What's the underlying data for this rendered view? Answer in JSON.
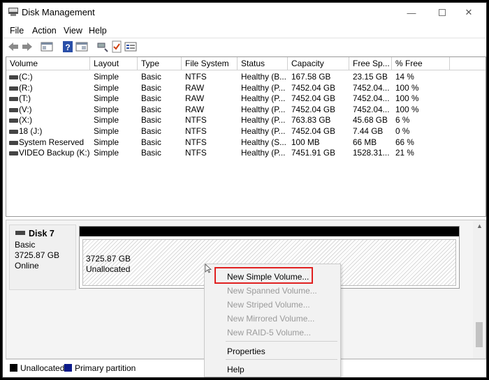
{
  "window": {
    "title": "Disk Management"
  },
  "menu": {
    "file": "File",
    "action": "Action",
    "view": "View",
    "help": "Help"
  },
  "toolbar": {
    "icons": [
      "back-arrow-icon",
      "forward-arrow-icon",
      "console-tree-icon",
      "help-icon",
      "properties-icon",
      "connect-icon",
      "checklist-icon",
      "view-icon"
    ]
  },
  "volume_table": {
    "headers": [
      "Volume",
      "Layout",
      "Type",
      "File System",
      "Status",
      "Capacity",
      "Free Sp...",
      "% Free"
    ],
    "rows": [
      {
        "volume": "(C:)",
        "layout": "Simple",
        "type": "Basic",
        "fs": "NTFS",
        "status": "Healthy (B...",
        "capacity": "167.58 GB",
        "free": "23.15 GB",
        "pct": "14 %"
      },
      {
        "volume": "(R:)",
        "layout": "Simple",
        "type": "Basic",
        "fs": "RAW",
        "status": "Healthy (P...",
        "capacity": "7452.04 GB",
        "free": "7452.04...",
        "pct": "100 %"
      },
      {
        "volume": "(T:)",
        "layout": "Simple",
        "type": "Basic",
        "fs": "RAW",
        "status": "Healthy (P...",
        "capacity": "7452.04 GB",
        "free": "7452.04...",
        "pct": "100 %"
      },
      {
        "volume": "(V:)",
        "layout": "Simple",
        "type": "Basic",
        "fs": "RAW",
        "status": "Healthy (P...",
        "capacity": "7452.04 GB",
        "free": "7452.04...",
        "pct": "100 %"
      },
      {
        "volume": "(X:)",
        "layout": "Simple",
        "type": "Basic",
        "fs": "NTFS",
        "status": "Healthy (P...",
        "capacity": "763.83 GB",
        "free": "45.68 GB",
        "pct": "6 %"
      },
      {
        "volume": "18 (J:)",
        "layout": "Simple",
        "type": "Basic",
        "fs": "NTFS",
        "status": "Healthy (P...",
        "capacity": "7452.04 GB",
        "free": "7.44 GB",
        "pct": "0 %"
      },
      {
        "volume": "System Reserved",
        "layout": "Simple",
        "type": "Basic",
        "fs": "NTFS",
        "status": "Healthy (S...",
        "capacity": "100 MB",
        "free": "66 MB",
        "pct": "66 %"
      },
      {
        "volume": "VIDEO Backup (K:)",
        "layout": "Simple",
        "type": "Basic",
        "fs": "NTFS",
        "status": "Healthy (P...",
        "capacity": "7451.91 GB",
        "free": "1528.31...",
        "pct": "21 %"
      }
    ]
  },
  "disk": {
    "name": "Disk 7",
    "type": "Basic",
    "size": "3725.87 GB",
    "status": "Online",
    "partition_size": "3725.87 GB",
    "partition_state": "Unallocated"
  },
  "legend": {
    "unallocated": "Unallocated",
    "primary": "Primary partition",
    "unallocated_color": "#000000",
    "primary_color": "#0b1a8a"
  },
  "context_menu": {
    "new_simple": "New Simple Volume...",
    "new_spanned": "New Spanned Volume...",
    "new_striped": "New Striped Volume...",
    "new_mirrored": "New Mirrored Volume...",
    "new_raid5": "New RAID-5 Volume...",
    "properties": "Properties",
    "help": "Help",
    "highlight_color": "#e02020"
  }
}
